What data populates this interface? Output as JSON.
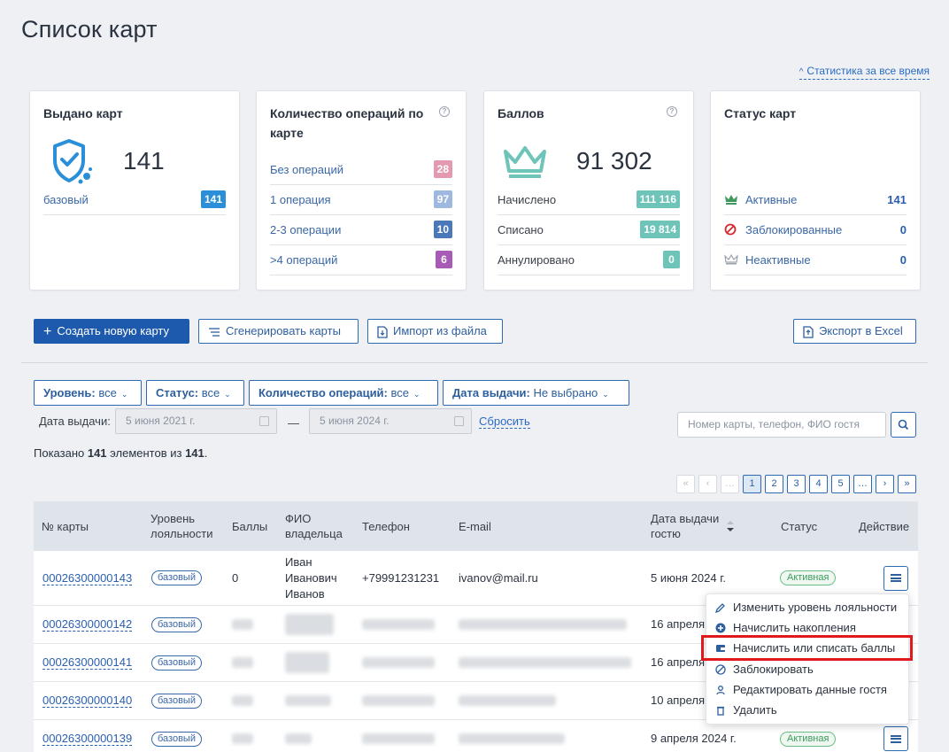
{
  "page": {
    "title": "Список карт",
    "stats_link": "Статистика за все время"
  },
  "cards": {
    "issued": {
      "title": "Выдано карт",
      "total": "141",
      "rows": [
        {
          "label": "базовый",
          "value": "141",
          "color": "#2a8fd8"
        }
      ]
    },
    "operations": {
      "title": "Количество операций по карте",
      "rows": [
        {
          "label": "Без операций",
          "value": "28",
          "color": "#e39ab0"
        },
        {
          "label": "1 операция",
          "value": "97",
          "color": "#9fb8df"
        },
        {
          "label": "2-3 операции",
          "value": "10",
          "color": "#4a78b8"
        },
        {
          "label": ">4 операций",
          "value": "6",
          "color": "#a85bb6"
        }
      ]
    },
    "points": {
      "title": "Баллов",
      "total": "91 302",
      "rows": [
        {
          "label": "Начислено",
          "value": "111 116",
          "color": "#6ec4b9"
        },
        {
          "label": "Списано",
          "value": "19 814",
          "color": "#6ec4b9"
        },
        {
          "label": "Аннулировано",
          "value": "0",
          "color": "#6ec4b9"
        }
      ]
    },
    "status": {
      "title": "Статус карт",
      "rows": [
        {
          "label": "Активные",
          "value": "141",
          "icon": "crown-green-icon"
        },
        {
          "label": "Заблокированные",
          "value": "0",
          "icon": "blocked-red-icon"
        },
        {
          "label": "Неактивные",
          "value": "0",
          "icon": "crown-grey-icon"
        }
      ]
    }
  },
  "toolbar": {
    "create": "Создать новую карту",
    "generate": "Сгенерировать карты",
    "import": "Импорт из файла",
    "export": "Экспорт в Excel"
  },
  "filters": {
    "level": {
      "label": "Уровень:",
      "value": "все"
    },
    "status": {
      "label": "Статус:",
      "value": "все"
    },
    "ops": {
      "label": "Количество операций:",
      "value": "все"
    },
    "date": {
      "label": "Дата выдачи:",
      "value": "Не выбрано"
    },
    "date_range_label": "Дата выдачи:",
    "date_from": "5 июня 2021 г.",
    "date_to": "5 июня 2024 г.",
    "dash": "—",
    "reset": "Сбросить",
    "search_placeholder": "Номер карты, телефон, ФИО гостя"
  },
  "summary": {
    "prefix": "Показано ",
    "count": "141",
    "middle": " элементов из ",
    "total": "141",
    "suffix": "."
  },
  "pager": [
    "«",
    "‹",
    "…",
    "1",
    "2",
    "3",
    "4",
    "5",
    "…",
    "›",
    "»"
  ],
  "table": {
    "headers": {
      "card": "№ карты",
      "level": "Уровень лояльности",
      "points": "Баллы",
      "owner": "ФИО владельца",
      "phone": "Телефон",
      "email": "E-mail",
      "date": "Дата выдачи гостю",
      "status": "Статус",
      "action": "Действие"
    },
    "rows": [
      {
        "card": "00026300000143",
        "level": "базовый",
        "points": "0",
        "owner": "Иван Иванович Иванов",
        "phone": "+79991231231",
        "email": "ivanov@mail.ru",
        "date": "5 июня 2024 г.",
        "status": "Активная"
      },
      {
        "card": "00026300000142",
        "level": "базовый",
        "date": "16 апреля"
      },
      {
        "card": "00026300000141",
        "level": "базовый",
        "date": "16 апреля"
      },
      {
        "card": "00026300000140",
        "level": "базовый",
        "date": "10 апреля"
      },
      {
        "card": "00026300000139",
        "level": "базовый",
        "date": "9 апреля 2024 г.",
        "status": "Активная"
      }
    ]
  },
  "menu": {
    "items": [
      {
        "label": "Изменить уровень лояльности",
        "icon": "pencil-icon"
      },
      {
        "label": "Начислить накопления",
        "icon": "plus-circle-icon"
      },
      {
        "label": "Начислить или списать баллы",
        "icon": "wallet-icon"
      },
      {
        "label": "Заблокировать",
        "icon": "block-icon"
      },
      {
        "label": "Редактировать данные гостя",
        "icon": "user-icon"
      },
      {
        "label": "Удалить",
        "icon": "trash-icon"
      }
    ]
  }
}
